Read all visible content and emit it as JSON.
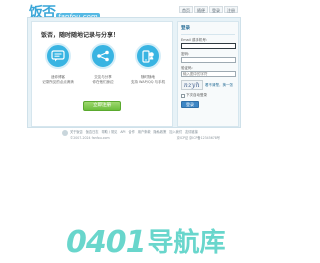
{
  "header": {
    "logo_text": "饭否",
    "logo_en": "fanfou.com",
    "nav": [
      "首页",
      "随便",
      "登录",
      "注册"
    ]
  },
  "promo": {
    "slogan": "饭否，随时随地记录与分享！",
    "features": [
      {
        "icon": "chat-icon",
        "line1": "迷你博客",
        "line2": "记录所见的点点滴滴"
      },
      {
        "icon": "share-icon",
        "line1": "交友与分享",
        "line2": "你在他们身边"
      },
      {
        "icon": "mobile-icon",
        "line1": "随时随地",
        "line2": "支持 WAP/QQ 与手机"
      }
    ],
    "join_button": "立即注册"
  },
  "login": {
    "title": "登录",
    "username_label": "Email 或手机号:",
    "username_placeholder": "",
    "password_label": "密码:",
    "password_placeholder": "",
    "captcha_label": "验证码:",
    "captcha_placeholder": "输入图中的字符",
    "captcha_text": "nzyh",
    "captcha_refresh": "看不清楚，换一张",
    "remember_label": "下次自动登录",
    "submit_label": "登录"
  },
  "footer": {
    "links": [
      "关于饭否",
      "饭否日志",
      "帮助 / 常见",
      "API",
      "合作",
      "用户条款",
      "隐私政策",
      "加入我们",
      "友情链接"
    ],
    "copyright": "©2007-2024 fanfou.com",
    "icp": "京ICP证 京ICP备12345678号"
  },
  "watermark": {
    "digits": "0401",
    "text": "导航库"
  },
  "colors": {
    "brand_blue": "#39b4e2",
    "join_green": "#6bbd3c",
    "login_blue": "#3d86c5",
    "watermark_teal": "#4fd0c4"
  }
}
